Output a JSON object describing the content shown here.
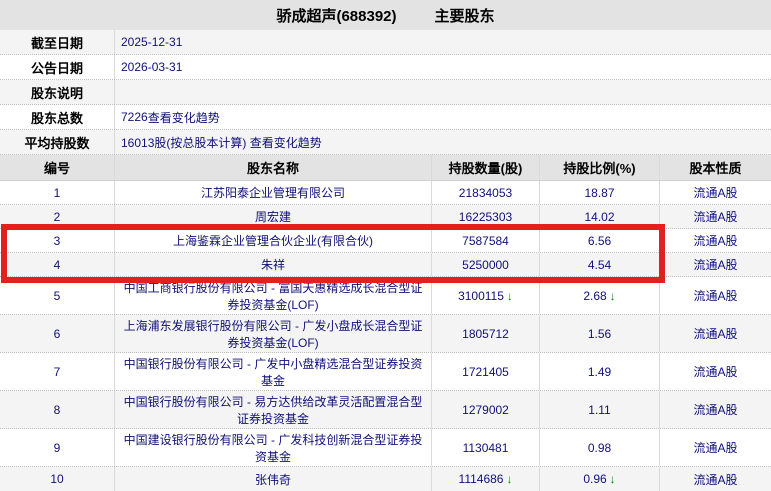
{
  "title": {
    "company": "骄成超声(688392)",
    "section": "主要股东"
  },
  "info_rows": [
    {
      "label": "截至日期",
      "value": "2025-12-31",
      "link": ""
    },
    {
      "label": "公告日期",
      "value": "2026-03-31",
      "link": ""
    },
    {
      "label": "股东说明",
      "value": "",
      "link": ""
    },
    {
      "label": "股东总数",
      "value": "7226",
      "link": "查看变化趋势"
    },
    {
      "label": "平均持股数",
      "value": "16013股(按总股本计算) ",
      "link": "查看变化趋势"
    }
  ],
  "table": {
    "headers": [
      "编号",
      "股东名称",
      "持股数量(股)",
      "持股比例(%)",
      "股本性质"
    ],
    "rows": [
      {
        "no": "1",
        "name": "江苏阳泰企业管理有限公司",
        "shares": "21834053",
        "shares_arrow": "",
        "pct": "18.87",
        "pct_arrow": "",
        "type": "流通A股"
      },
      {
        "no": "2",
        "name": "周宏建",
        "shares": "16225303",
        "shares_arrow": "",
        "pct": "14.02",
        "pct_arrow": "",
        "type": "流通A股"
      },
      {
        "no": "3",
        "name": "上海鉴霖企业管理合伙企业(有限合伙)",
        "shares": "7587584",
        "shares_arrow": "",
        "pct": "6.56",
        "pct_arrow": "",
        "type": "流通A股"
      },
      {
        "no": "4",
        "name": "朱祥",
        "shares": "5250000",
        "shares_arrow": "",
        "pct": "4.54",
        "pct_arrow": "",
        "type": "流通A股"
      },
      {
        "no": "5",
        "name": "中国工商银行股份有限公司 - 富国天惠精选成长混合型证券投资基金(LOF)",
        "shares": "3100115",
        "shares_arrow": "↓",
        "pct": "2.68",
        "pct_arrow": "↓",
        "type": "流通A股"
      },
      {
        "no": "6",
        "name": "上海浦东发展银行股份有限公司 - 广发小盘成长混合型证券投资基金(LOF)",
        "shares": "1805712",
        "shares_arrow": "",
        "pct": "1.56",
        "pct_arrow": "",
        "type": "流通A股"
      },
      {
        "no": "7",
        "name": "中国银行股份有限公司 - 广发中小盘精选混合型证券投资基金",
        "shares": "1721405",
        "shares_arrow": "",
        "pct": "1.49",
        "pct_arrow": "",
        "type": "流通A股"
      },
      {
        "no": "8",
        "name": "中国银行股份有限公司 - 易方达供给改革灵活配置混合型证券投资基金",
        "shares": "1279002",
        "shares_arrow": "",
        "pct": "1.11",
        "pct_arrow": "",
        "type": "流通A股"
      },
      {
        "no": "9",
        "name": "中国建设银行股份有限公司 - 广发科技创新混合型证券投资基金",
        "shares": "1130481",
        "shares_arrow": "",
        "pct": "0.98",
        "pct_arrow": "",
        "type": "流通A股"
      },
      {
        "no": "10",
        "name": "张伟奇",
        "shares": "1114686",
        "shares_arrow": "↓",
        "pct": "0.96",
        "pct_arrow": "↓",
        "type": "流通A股"
      }
    ]
  },
  "colors": {
    "highlight_red": "#e22020",
    "down_green": "#0a8a0a",
    "data_navy": "#10107a",
    "header_gray": "#e3e3e3"
  },
  "icons": {
    "down_arrow": "↓"
  }
}
